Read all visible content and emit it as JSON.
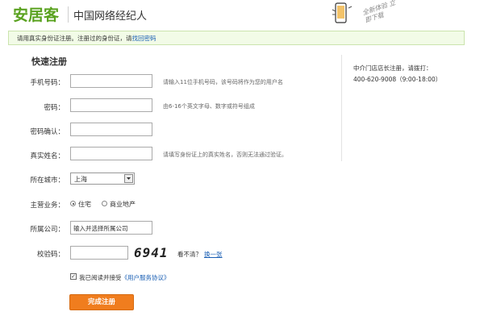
{
  "header": {
    "logo": "安居客",
    "title": "中国网络经纪人",
    "promo_text": "全新体验 立即下载"
  },
  "notice": {
    "text": "请用真实身份证注册。注册过的身份证，请",
    "link": "找回密码"
  },
  "form": {
    "title": "快速注册",
    "phone": {
      "label": "手机号码：",
      "value": "",
      "hint": "请输入11位手机号码，该号码将作为您的用户名"
    },
    "password": {
      "label": "密码：",
      "value": "",
      "hint": "由6-16个英文字母、数字或符号组成"
    },
    "confirm": {
      "label": "密码确认：",
      "value": ""
    },
    "realname": {
      "label": "真实姓名：",
      "value": "",
      "hint": "请填写身份证上的真实姓名，否则无法通过验证。"
    },
    "city": {
      "label": "所在城市：",
      "value": "上海"
    },
    "business": {
      "label": "主营业务：",
      "options": [
        {
          "label": "住宅",
          "selected": true
        },
        {
          "label": "商业地产",
          "selected": false
        }
      ]
    },
    "company": {
      "label": "所属公司：",
      "value": "输入并选择所属公司"
    },
    "captcha": {
      "label": "校验码：",
      "value": "",
      "image_text": "6941",
      "question": "看不清？",
      "change": "换一张"
    },
    "agree": {
      "checked": true,
      "text": "我已阅读并接受",
      "link": "《用户服务协议》"
    },
    "submit": "完成注册"
  },
  "sidebar": {
    "title": "中介门店店长注册，请拨打：",
    "phone": "400-620-9008（9:00-18:00）"
  },
  "colors": {
    "brand": "#5aa220",
    "accent": "#f07d1e",
    "link": "#1a5fb4"
  }
}
